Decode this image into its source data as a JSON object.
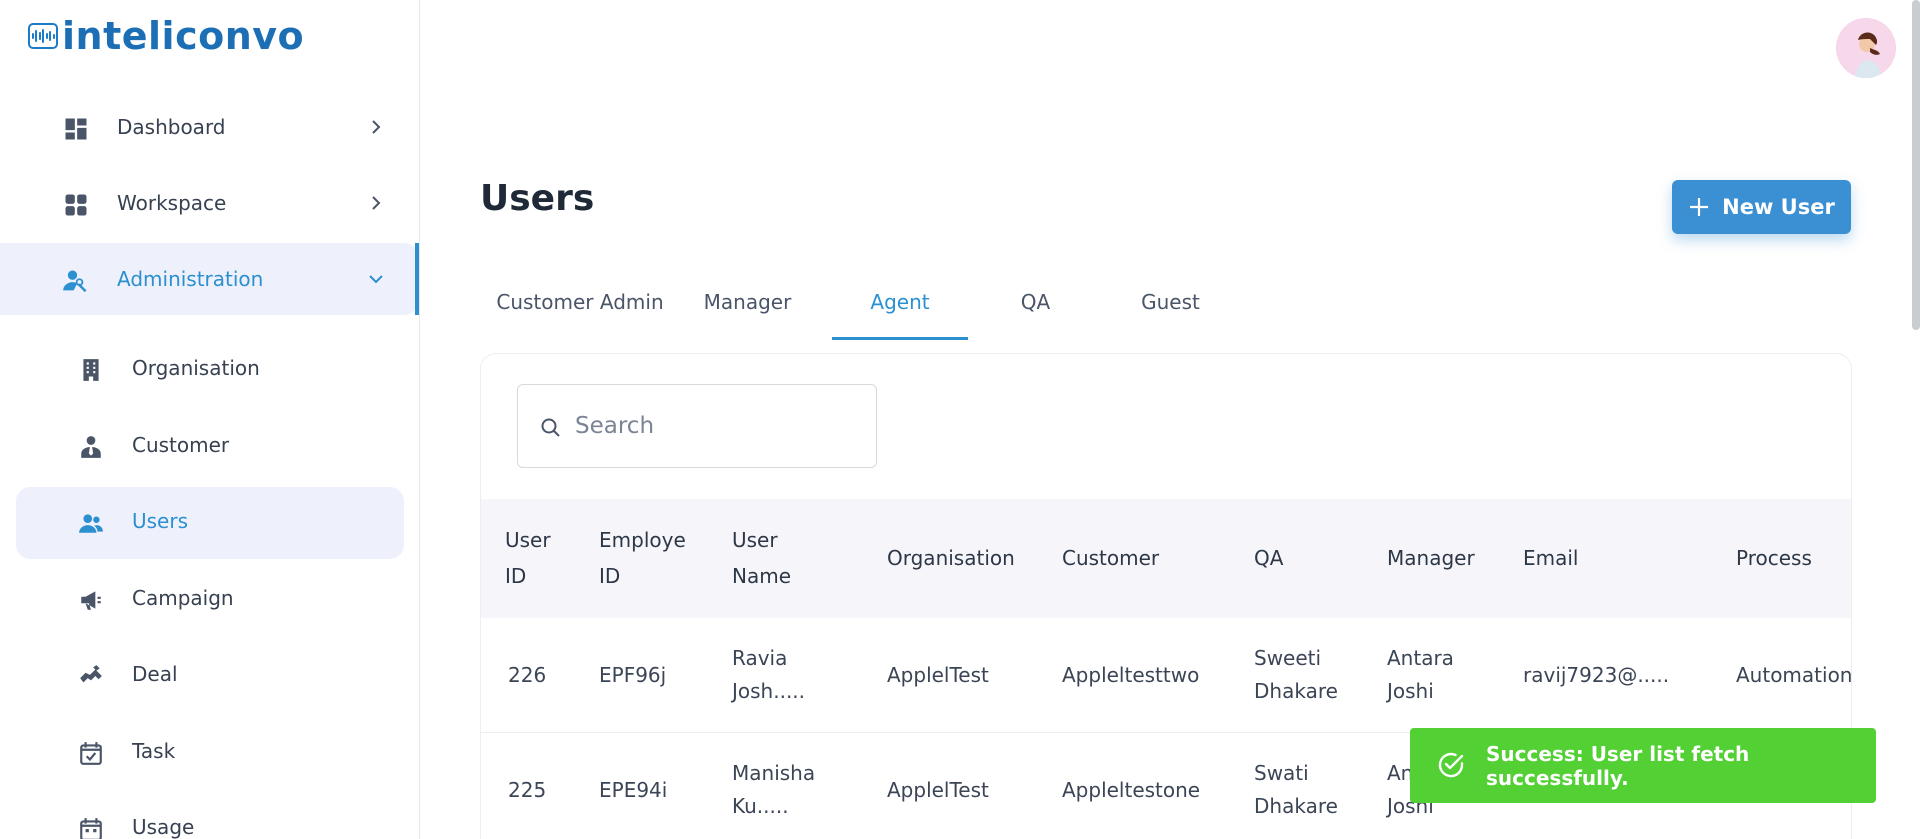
{
  "brand": {
    "name": "inteliconvo"
  },
  "sidebar": {
    "items": [
      {
        "label": "Dashboard",
        "icon": "dashboard-icon"
      },
      {
        "label": "Workspace",
        "icon": "workspace-icon"
      },
      {
        "label": "Administration",
        "icon": "administration-icon"
      }
    ],
    "sub_items": [
      {
        "label": "Organisation",
        "icon": "building-icon"
      },
      {
        "label": "Customer",
        "icon": "customer-icon"
      },
      {
        "label": "Users",
        "icon": "users-icon"
      },
      {
        "label": "Campaign",
        "icon": "megaphone-icon"
      },
      {
        "label": "Deal",
        "icon": "handshake-icon"
      },
      {
        "label": "Task",
        "icon": "calendar-check-icon"
      },
      {
        "label": "Usage",
        "icon": "calendar-icon"
      }
    ]
  },
  "page": {
    "title": "Users",
    "new_user_label": "New User",
    "tabs": [
      {
        "label": "Customer Admin"
      },
      {
        "label": "Manager"
      },
      {
        "label": "Agent"
      },
      {
        "label": "QA"
      },
      {
        "label": "Guest"
      }
    ],
    "active_tab": "Agent",
    "search_placeholder": "Search"
  },
  "table": {
    "headers": [
      {
        "line1": "User",
        "line2": "ID"
      },
      {
        "line1": "Employe",
        "line2": "ID"
      },
      {
        "line1": "User",
        "line2": "Name"
      },
      {
        "line1": "Organisation",
        "line2": ""
      },
      {
        "line1": "Customer",
        "line2": ""
      },
      {
        "line1": "QA",
        "line2": ""
      },
      {
        "line1": "Manager",
        "line2": ""
      },
      {
        "line1": "Email",
        "line2": ""
      },
      {
        "line1": "Process",
        "line2": ""
      }
    ],
    "rows": [
      {
        "user_id": "226",
        "employee_id": "EPF96j",
        "user_name": [
          "Ravia",
          "Josh....."
        ],
        "organisation": "ApplelTest",
        "customer": "Appleltesttwo",
        "qa": [
          "Sweeti",
          "Dhakare"
        ],
        "manager": [
          "Antara",
          "Joshi"
        ],
        "email": "ravij7923@.....",
        "process": "Automation"
      },
      {
        "user_id": "225",
        "employee_id": "EPE94i",
        "user_name": [
          "Manisha",
          "Ku....."
        ],
        "organisation": "ApplelTest",
        "customer": "Appleltestone",
        "qa": [
          "Swati",
          "Dhakare"
        ],
        "manager": [
          "Antara",
          "Joshi"
        ],
        "email": "",
        "process": ""
      }
    ]
  },
  "toast": {
    "message": "Success: User list fetch successfully.",
    "color": "#52d034"
  },
  "colors": {
    "accent": "#2b8fd0",
    "primary_button": "#3b8fd3",
    "brand": "#1c6fb5"
  }
}
